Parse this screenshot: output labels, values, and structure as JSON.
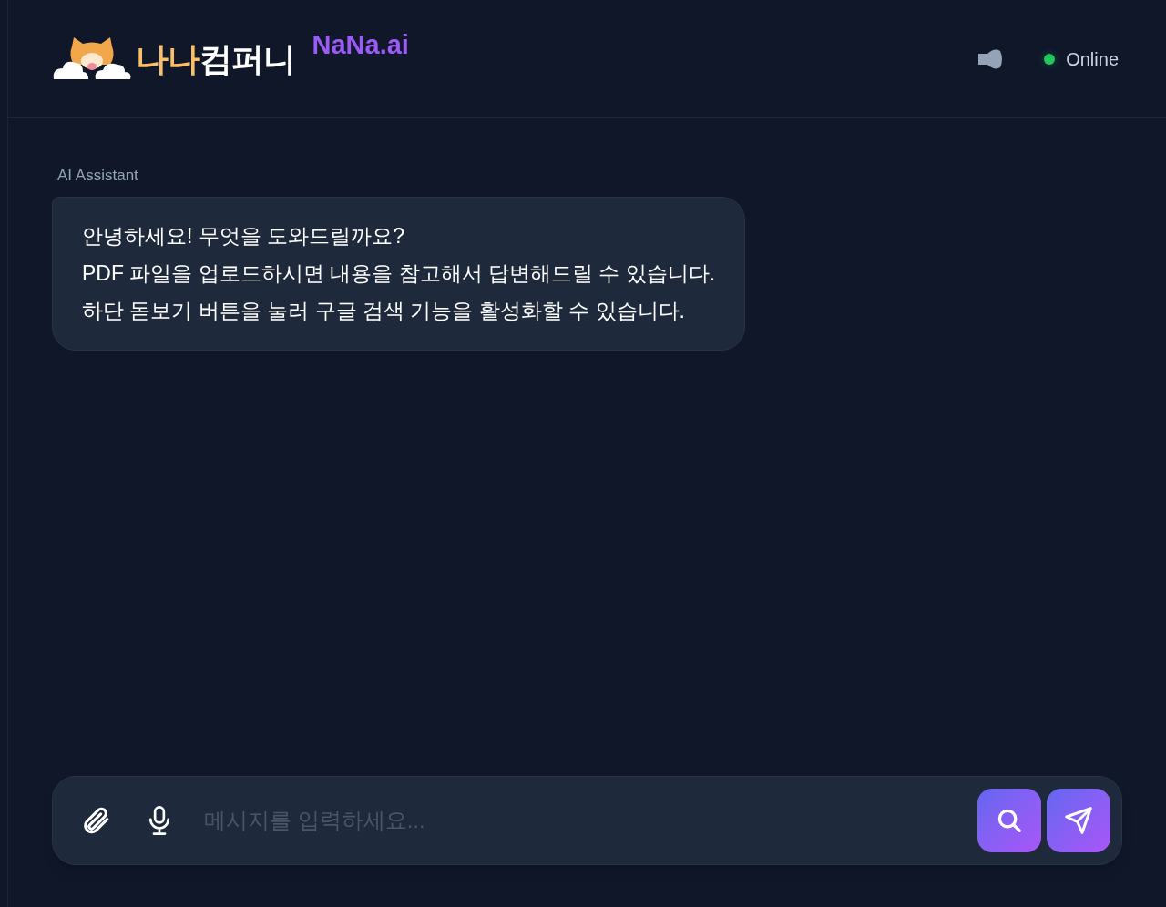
{
  "header": {
    "logo_parts": [
      {
        "text": "나나",
        "color": "#fbbf6a"
      },
      {
        "text": "컴퍼니",
        "color": "#ffffff"
      }
    ],
    "brand_tag": "NaNa.ai",
    "status": {
      "label": "Online",
      "online": true
    }
  },
  "messages": [
    {
      "kind": "assistant",
      "sender": "AI Assistant",
      "text": "안녕하세요! 무엇을 도와드릴까요?\nPDF 파일을 업로드하시면 내용을 참고해서 답변해드릴 수 있습니다.\n하단 돋보기 버튼을 눌러 구글 검색 기능을 활성화할 수 있습니다."
    }
  ],
  "composer": {
    "placeholder": "메시지를 입력하세요..."
  }
}
